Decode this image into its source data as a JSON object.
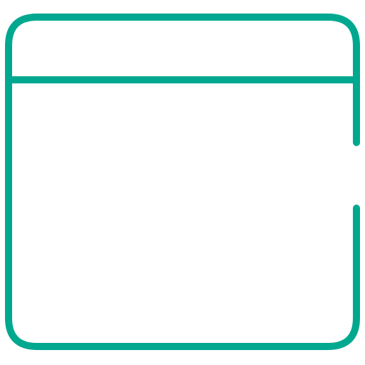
{
  "icon": {
    "name": "browser-window-icon",
    "stroke_color": "#00A88F",
    "background_color": "#FFFFFF"
  }
}
